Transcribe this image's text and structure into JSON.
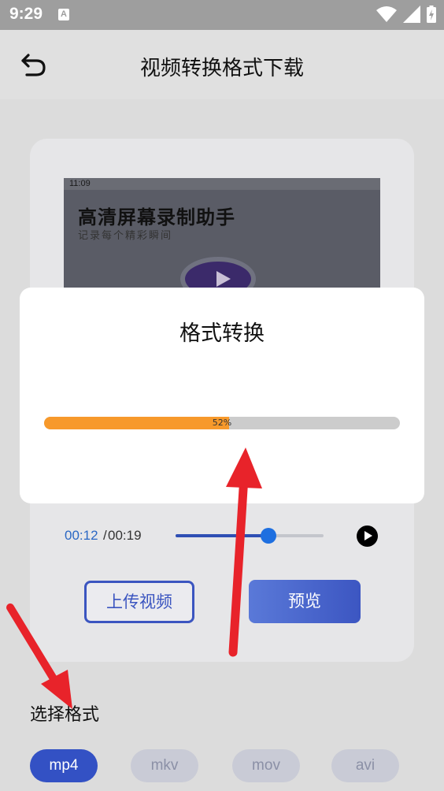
{
  "status_bar": {
    "time": "9:29",
    "notification_badge": "A"
  },
  "header": {
    "title": "视频转换格式下载"
  },
  "video_preview": {
    "inner_time": "11:09",
    "inner_title": "高清屏幕录制助手",
    "inner_subtitle": "记录每个精彩瞬间"
  },
  "player": {
    "current_time": "00:12",
    "separator": "/",
    "total_time": "00:19",
    "position_fraction": 0.63
  },
  "buttons": {
    "upload_label": "上传视频",
    "preview_label": "预览"
  },
  "format_section": {
    "label": "选择格式",
    "options": [
      "mp4",
      "mkv",
      "mov",
      "avi"
    ],
    "selected": "mp4"
  },
  "dialog": {
    "title": "格式转换",
    "progress_percent": 52,
    "progress_label": "52%"
  },
  "colors": {
    "accent": "#3351c4",
    "progress": "#f7992b",
    "annotation": "#e8232a"
  }
}
